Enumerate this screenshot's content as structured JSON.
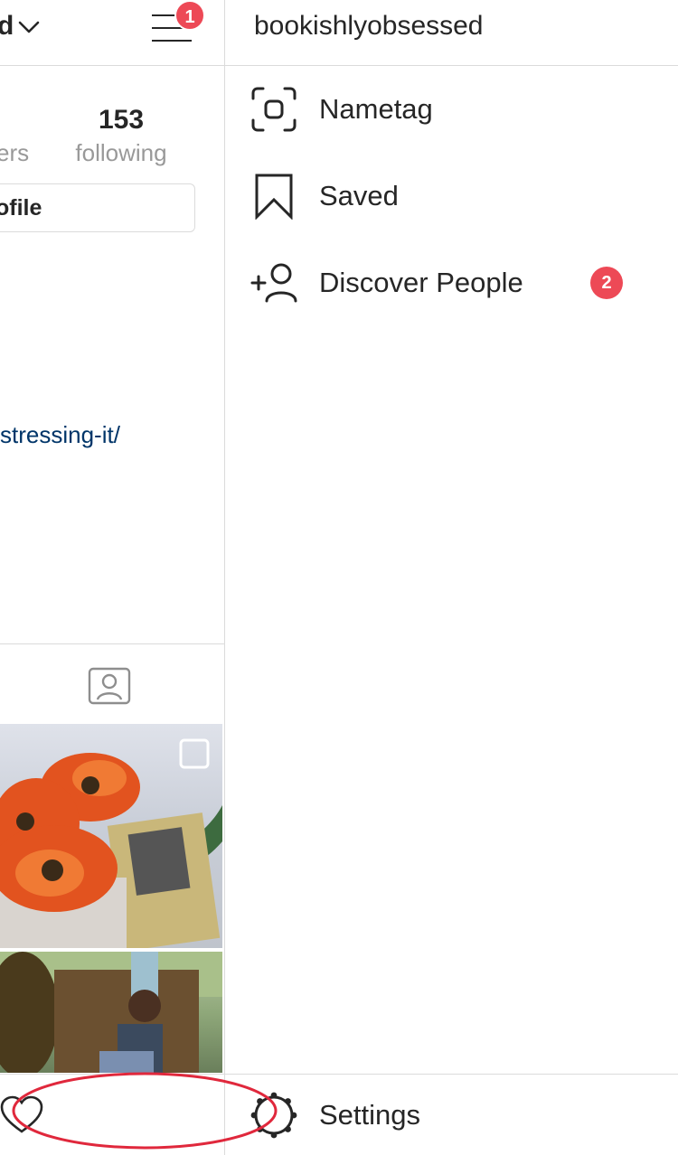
{
  "left": {
    "username_fragment": "d",
    "notification_count": "1",
    "following_count": "153",
    "following_label": "following",
    "followers_label_fragment": "ers",
    "edit_profile_fragment": "ofile",
    "bio_link_fragment": "stressing-it/"
  },
  "drawer": {
    "username": "bookishlyobsessed",
    "items": [
      {
        "label": "Nametag",
        "icon": "nametag-icon"
      },
      {
        "label": "Saved",
        "icon": "bookmark-icon"
      },
      {
        "label": "Discover People",
        "icon": "add-person-icon",
        "badge": "2"
      }
    ],
    "settings_label": "Settings"
  },
  "colors": {
    "badge": "#ed4956",
    "link": "#003569",
    "divider": "#dbdbdb",
    "annotation": "#e0283c"
  }
}
